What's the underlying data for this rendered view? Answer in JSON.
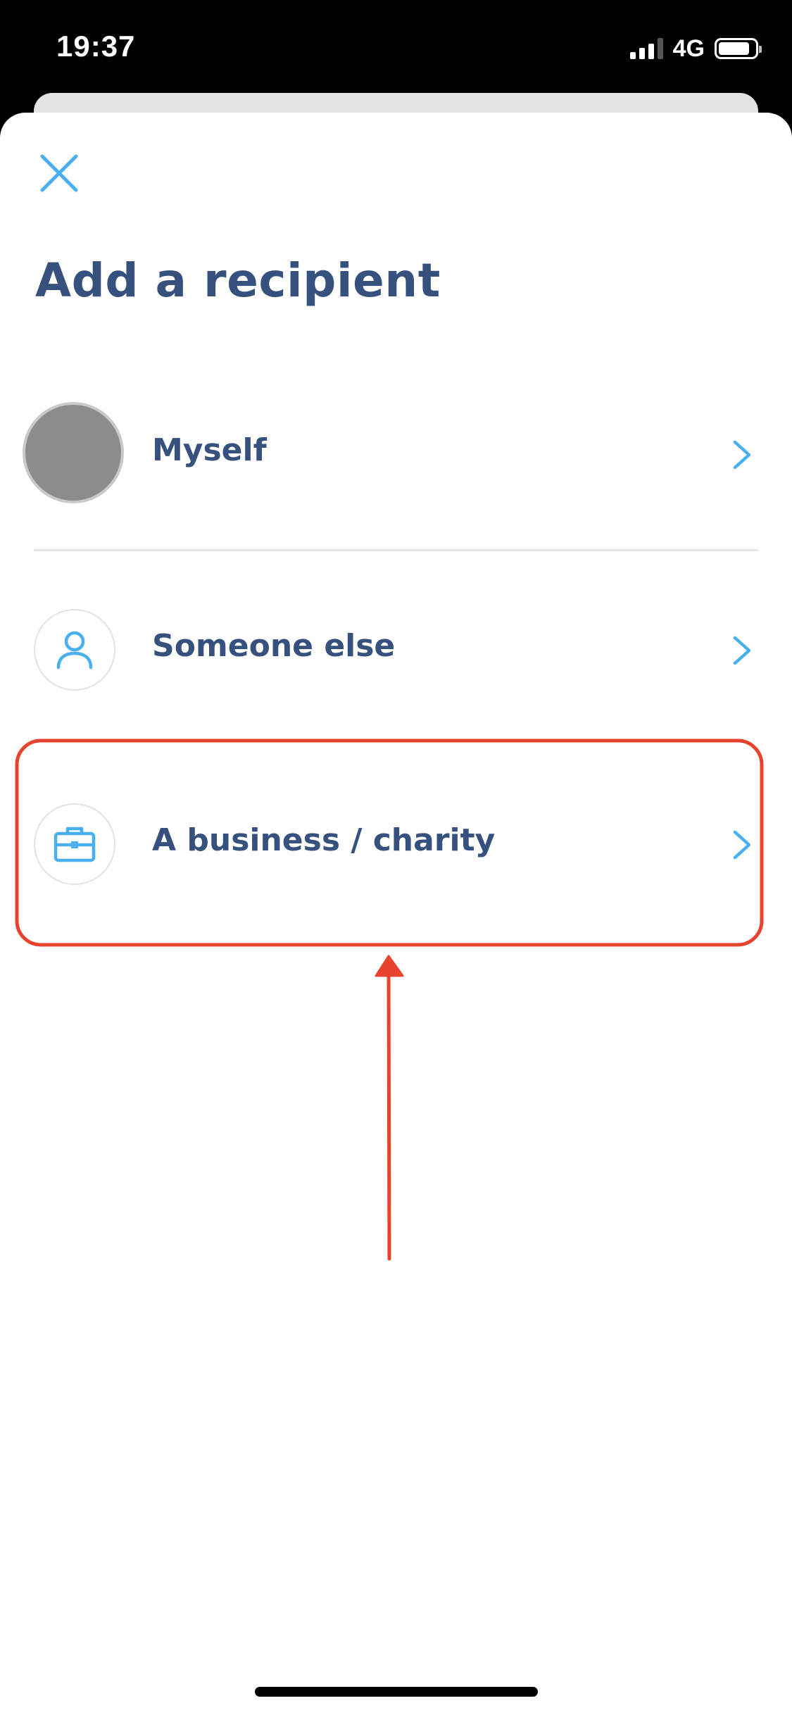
{
  "status_bar": {
    "time": "19:37",
    "network": "4G",
    "battery_level": 0.85
  },
  "sheet": {
    "close_icon": "close-icon",
    "title": "Add a recipient"
  },
  "options": [
    {
      "label": "Myself",
      "icon": "avatar",
      "chevron_icon": "chevron-right-icon"
    },
    {
      "label": "Someone else",
      "icon": "person-icon",
      "chevron_icon": "chevron-right-icon"
    },
    {
      "label": "A business / charity",
      "icon": "briefcase-icon",
      "chevron_icon": "chevron-right-icon"
    }
  ],
  "colors": {
    "accent": "#4aaff0",
    "title": "#37517e",
    "annotation": "#e8432f"
  }
}
